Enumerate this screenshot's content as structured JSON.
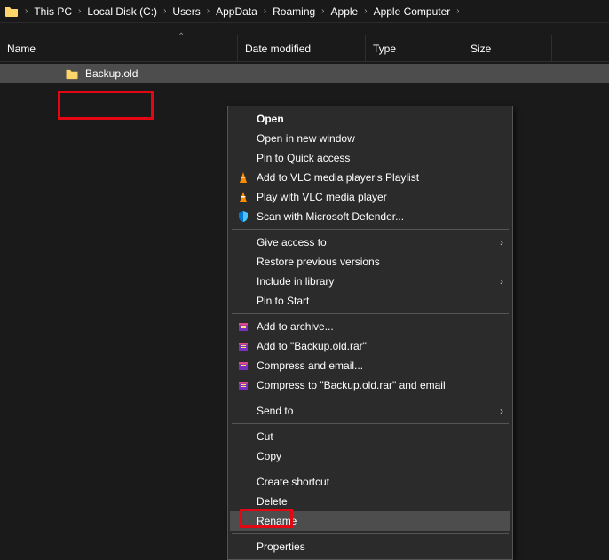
{
  "breadcrumb": {
    "items": [
      "This PC",
      "Local Disk (C:)",
      "Users",
      "AppData",
      "Roaming",
      "Apple",
      "Apple Computer"
    ]
  },
  "columns": {
    "name": "Name",
    "date": "Date modified",
    "type": "Type",
    "size": "Size"
  },
  "file": {
    "name": "Backup.old"
  },
  "menu": {
    "open": "Open",
    "open_new_window": "Open in new window",
    "pin_quick_access": "Pin to Quick access",
    "vlc_playlist": "Add to VLC media player's Playlist",
    "vlc_play": "Play with VLC media player",
    "defender": "Scan with Microsoft Defender...",
    "give_access": "Give access to",
    "restore_prev": "Restore previous versions",
    "include_library": "Include in library",
    "pin_start": "Pin to Start",
    "add_archive": "Add to archive...",
    "add_rar": "Add to \"Backup.old.rar\"",
    "compress_email": "Compress and email...",
    "compress_rar_email": "Compress to \"Backup.old.rar\" and email",
    "send_to": "Send to",
    "cut": "Cut",
    "copy": "Copy",
    "create_shortcut": "Create shortcut",
    "delete": "Delete",
    "rename": "Rename",
    "properties": "Properties"
  }
}
